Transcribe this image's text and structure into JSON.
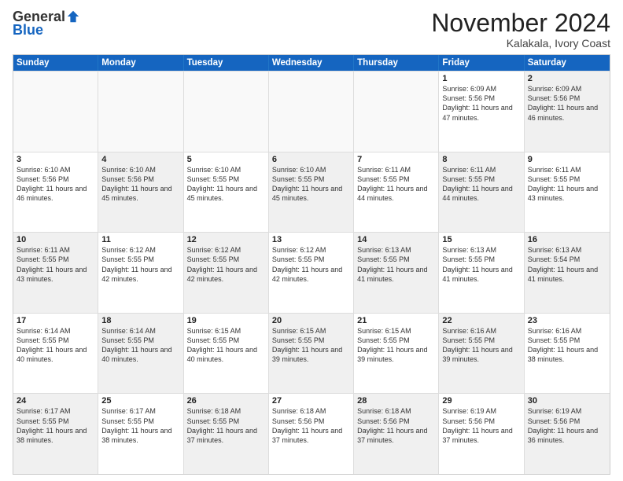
{
  "header": {
    "logo_general": "General",
    "logo_blue": "Blue",
    "month_title": "November 2024",
    "location": "Kalakala, Ivory Coast"
  },
  "calendar": {
    "days_of_week": [
      "Sunday",
      "Monday",
      "Tuesday",
      "Wednesday",
      "Thursday",
      "Friday",
      "Saturday"
    ],
    "rows": [
      [
        {
          "day": "",
          "empty": true
        },
        {
          "day": "",
          "empty": true
        },
        {
          "day": "",
          "empty": true
        },
        {
          "day": "",
          "empty": true
        },
        {
          "day": "",
          "empty": true
        },
        {
          "day": "1",
          "sunrise": "6:09 AM",
          "sunset": "5:56 PM",
          "daylight": "11 hours and 47 minutes.",
          "shaded": false
        },
        {
          "day": "2",
          "sunrise": "6:09 AM",
          "sunset": "5:56 PM",
          "daylight": "11 hours and 46 minutes.",
          "shaded": true
        }
      ],
      [
        {
          "day": "3",
          "sunrise": "6:10 AM",
          "sunset": "5:56 PM",
          "daylight": "11 hours and 46 minutes.",
          "shaded": false
        },
        {
          "day": "4",
          "sunrise": "6:10 AM",
          "sunset": "5:56 PM",
          "daylight": "11 hours and 45 minutes.",
          "shaded": true
        },
        {
          "day": "5",
          "sunrise": "6:10 AM",
          "sunset": "5:55 PM",
          "daylight": "11 hours and 45 minutes.",
          "shaded": false
        },
        {
          "day": "6",
          "sunrise": "6:10 AM",
          "sunset": "5:55 PM",
          "daylight": "11 hours and 45 minutes.",
          "shaded": true
        },
        {
          "day": "7",
          "sunrise": "6:11 AM",
          "sunset": "5:55 PM",
          "daylight": "11 hours and 44 minutes.",
          "shaded": false
        },
        {
          "day": "8",
          "sunrise": "6:11 AM",
          "sunset": "5:55 PM",
          "daylight": "11 hours and 44 minutes.",
          "shaded": true
        },
        {
          "day": "9",
          "sunrise": "6:11 AM",
          "sunset": "5:55 PM",
          "daylight": "11 hours and 43 minutes.",
          "shaded": false
        }
      ],
      [
        {
          "day": "10",
          "sunrise": "6:11 AM",
          "sunset": "5:55 PM",
          "daylight": "11 hours and 43 minutes.",
          "shaded": true
        },
        {
          "day": "11",
          "sunrise": "6:12 AM",
          "sunset": "5:55 PM",
          "daylight": "11 hours and 42 minutes.",
          "shaded": false
        },
        {
          "day": "12",
          "sunrise": "6:12 AM",
          "sunset": "5:55 PM",
          "daylight": "11 hours and 42 minutes.",
          "shaded": true
        },
        {
          "day": "13",
          "sunrise": "6:12 AM",
          "sunset": "5:55 PM",
          "daylight": "11 hours and 42 minutes.",
          "shaded": false
        },
        {
          "day": "14",
          "sunrise": "6:13 AM",
          "sunset": "5:55 PM",
          "daylight": "11 hours and 41 minutes.",
          "shaded": true
        },
        {
          "day": "15",
          "sunrise": "6:13 AM",
          "sunset": "5:55 PM",
          "daylight": "11 hours and 41 minutes.",
          "shaded": false
        },
        {
          "day": "16",
          "sunrise": "6:13 AM",
          "sunset": "5:54 PM",
          "daylight": "11 hours and 41 minutes.",
          "shaded": true
        }
      ],
      [
        {
          "day": "17",
          "sunrise": "6:14 AM",
          "sunset": "5:55 PM",
          "daylight": "11 hours and 40 minutes.",
          "shaded": false
        },
        {
          "day": "18",
          "sunrise": "6:14 AM",
          "sunset": "5:55 PM",
          "daylight": "11 hours and 40 minutes.",
          "shaded": true
        },
        {
          "day": "19",
          "sunrise": "6:15 AM",
          "sunset": "5:55 PM",
          "daylight": "11 hours and 40 minutes.",
          "shaded": false
        },
        {
          "day": "20",
          "sunrise": "6:15 AM",
          "sunset": "5:55 PM",
          "daylight": "11 hours and 39 minutes.",
          "shaded": true
        },
        {
          "day": "21",
          "sunrise": "6:15 AM",
          "sunset": "5:55 PM",
          "daylight": "11 hours and 39 minutes.",
          "shaded": false
        },
        {
          "day": "22",
          "sunrise": "6:16 AM",
          "sunset": "5:55 PM",
          "daylight": "11 hours and 39 minutes.",
          "shaded": true
        },
        {
          "day": "23",
          "sunrise": "6:16 AM",
          "sunset": "5:55 PM",
          "daylight": "11 hours and 38 minutes.",
          "shaded": false
        }
      ],
      [
        {
          "day": "24",
          "sunrise": "6:17 AM",
          "sunset": "5:55 PM",
          "daylight": "11 hours and 38 minutes.",
          "shaded": true
        },
        {
          "day": "25",
          "sunrise": "6:17 AM",
          "sunset": "5:55 PM",
          "daylight": "11 hours and 38 minutes.",
          "shaded": false
        },
        {
          "day": "26",
          "sunrise": "6:18 AM",
          "sunset": "5:55 PM",
          "daylight": "11 hours and 37 minutes.",
          "shaded": true
        },
        {
          "day": "27",
          "sunrise": "6:18 AM",
          "sunset": "5:56 PM",
          "daylight": "11 hours and 37 minutes.",
          "shaded": false
        },
        {
          "day": "28",
          "sunrise": "6:18 AM",
          "sunset": "5:56 PM",
          "daylight": "11 hours and 37 minutes.",
          "shaded": true
        },
        {
          "day": "29",
          "sunrise": "6:19 AM",
          "sunset": "5:56 PM",
          "daylight": "11 hours and 37 minutes.",
          "shaded": false
        },
        {
          "day": "30",
          "sunrise": "6:19 AM",
          "sunset": "5:56 PM",
          "daylight": "11 hours and 36 minutes.",
          "shaded": true
        }
      ]
    ]
  }
}
